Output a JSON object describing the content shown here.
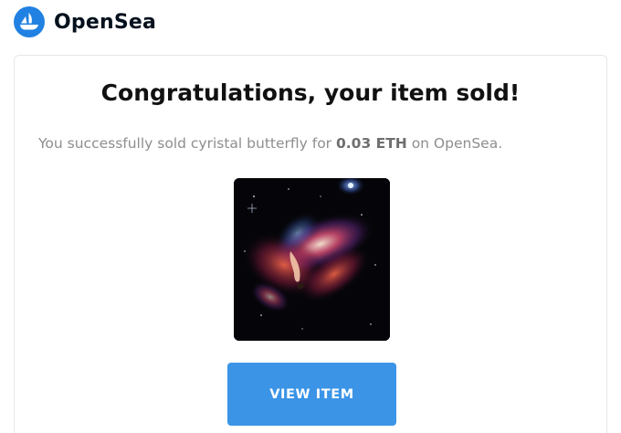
{
  "header": {
    "brand": "OpenSea",
    "logo_icon": "opensea-ship-icon",
    "brand_color": "#2081e2"
  },
  "card": {
    "title": "Congratulations, your item sold!",
    "message": {
      "prefix": "You successfully sold cyristal butterfly for ",
      "price": "0.03 ETH",
      "suffix": " on OpenSea."
    },
    "item": {
      "image_description": "nft-artwork-image"
    },
    "button": {
      "label": "VIEW ITEM",
      "color": "#3b94e6"
    }
  }
}
